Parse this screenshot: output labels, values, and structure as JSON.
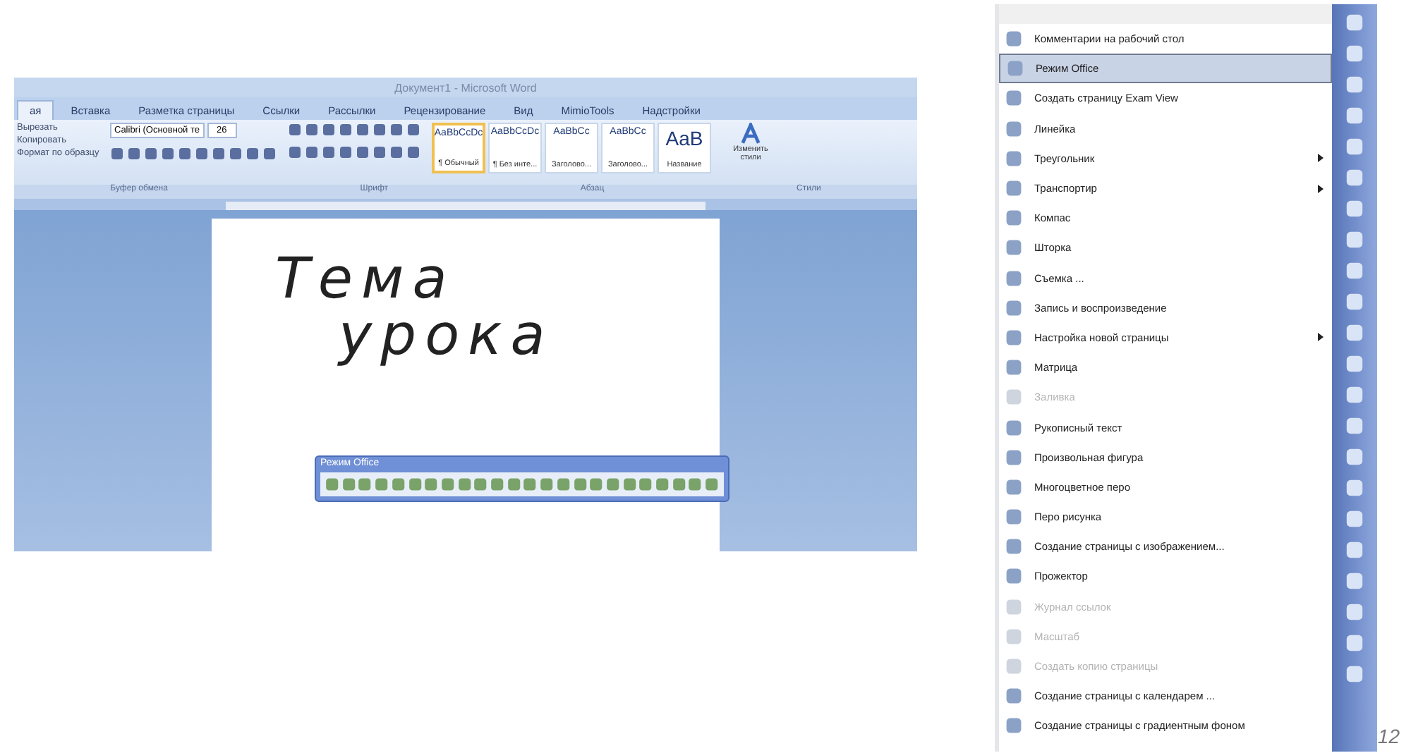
{
  "word": {
    "title": "Документ1 - Microsoft Word",
    "tabs": [
      {
        "label": "ая",
        "selected": true
      },
      {
        "label": "Вставка",
        "selected": false
      },
      {
        "label": "Разметка страницы",
        "selected": false
      },
      {
        "label": "Ссылки",
        "selected": false
      },
      {
        "label": "Рассылки",
        "selected": false
      },
      {
        "label": "Рецензирование",
        "selected": false
      },
      {
        "label": "Вид",
        "selected": false
      },
      {
        "label": "MimioTools",
        "selected": false
      },
      {
        "label": "Надстройки",
        "selected": false
      }
    ],
    "clipboard": [
      "Вырезать",
      "Копировать",
      "Формат по образцу"
    ],
    "font": {
      "name": "Calibri (Основной те",
      "size": "26"
    },
    "styles": [
      {
        "sample": "AaBbCcDc",
        "label": "¶ Обычный",
        "selected": true
      },
      {
        "sample": "AaBbCcDc",
        "label": "¶ Без инте...",
        "selected": false
      },
      {
        "sample": "AaBbCc",
        "label": "Заголово...",
        "selected": false
      },
      {
        "sample": "AaBbCc",
        "label": "Заголово...",
        "selected": false
      },
      {
        "sample": "AaB",
        "label": "Название",
        "selected": false
      }
    ],
    "change_styles": "Изменить стили",
    "groups": [
      "Буфер обмена",
      "Шрифт",
      "Абзац",
      "Стили"
    ],
    "ink": [
      "Тема",
      "урока"
    ],
    "office_toolbar": {
      "title": "Режим Office"
    }
  },
  "menu": {
    "items": [
      {
        "label": "Комментарии на рабочий стол",
        "selected": false,
        "disabled": false,
        "submenu": false
      },
      {
        "label": "Режим Office",
        "selected": true,
        "disabled": false,
        "submenu": false
      },
      {
        "label": "Создать страницу Exam View",
        "selected": false,
        "disabled": false,
        "submenu": false
      },
      {
        "label": "Линейка",
        "selected": false,
        "disabled": false,
        "submenu": false
      },
      {
        "label": "Треугольник",
        "selected": false,
        "disabled": false,
        "submenu": true
      },
      {
        "label": "Транспортир",
        "selected": false,
        "disabled": false,
        "submenu": true
      },
      {
        "label": "Компас",
        "selected": false,
        "disabled": false,
        "submenu": false
      },
      {
        "label": "Шторка",
        "selected": false,
        "disabled": false,
        "submenu": false
      },
      {
        "label": "Съемка ...",
        "selected": false,
        "disabled": false,
        "submenu": false
      },
      {
        "label": "Запись и воспроизведение",
        "selected": false,
        "disabled": false,
        "submenu": false
      },
      {
        "label": "Настройка новой страницы",
        "selected": false,
        "disabled": false,
        "submenu": true
      },
      {
        "label": "Матрица",
        "selected": false,
        "disabled": false,
        "submenu": false
      },
      {
        "label": "Заливка",
        "selected": false,
        "disabled": true,
        "submenu": false
      },
      {
        "label": "Рукописный текст",
        "selected": false,
        "disabled": false,
        "submenu": false
      },
      {
        "label": "Произвольная фигура",
        "selected": false,
        "disabled": false,
        "submenu": false
      },
      {
        "label": "Многоцветное перо",
        "selected": false,
        "disabled": false,
        "submenu": false
      },
      {
        "label": "Перо рисунка",
        "selected": false,
        "disabled": false,
        "submenu": false
      },
      {
        "label": "Создание страницы с изображением...",
        "selected": false,
        "disabled": false,
        "submenu": false
      },
      {
        "label": "Прожектор",
        "selected": false,
        "disabled": false,
        "submenu": false
      },
      {
        "label": "Журнал ссылок",
        "selected": false,
        "disabled": true,
        "submenu": false
      },
      {
        "label": "Масштаб",
        "selected": false,
        "disabled": true,
        "submenu": false
      },
      {
        "label": "Создать копию страницы",
        "selected": false,
        "disabled": true,
        "submenu": false
      },
      {
        "label": "Создание страницы с календарем ...",
        "selected": false,
        "disabled": false,
        "submenu": false
      },
      {
        "label": "Создание страницы с градиентным фоном",
        "selected": false,
        "disabled": false,
        "submenu": false
      }
    ]
  },
  "page_number": "12"
}
